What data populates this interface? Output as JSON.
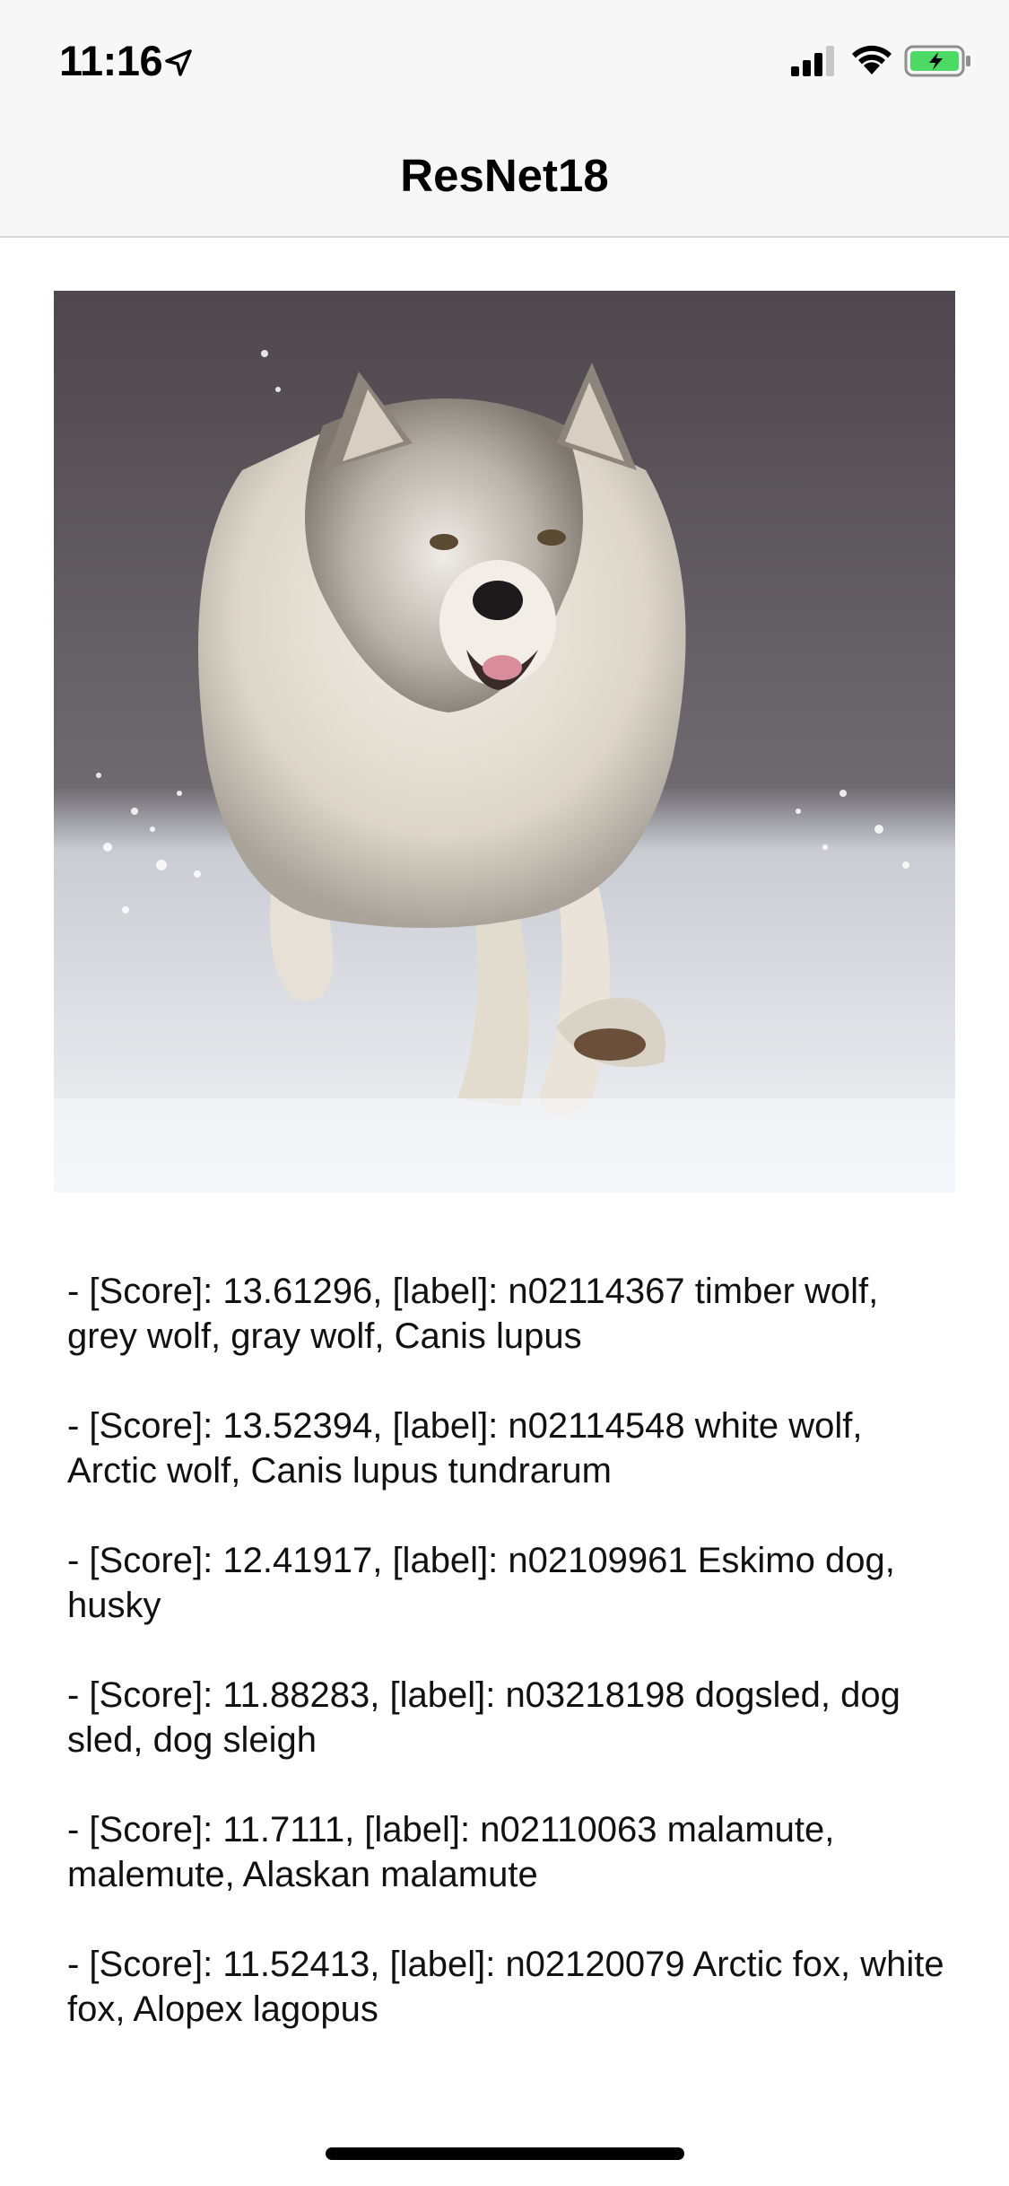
{
  "status_bar": {
    "time": "11:16",
    "icons": [
      "location-arrow-icon",
      "cellular-signal-icon",
      "wifi-icon",
      "battery-charging-icon"
    ],
    "battery_color": "#4cd964"
  },
  "nav": {
    "title": "ResNet18"
  },
  "photo": {
    "subject": "wolf-photo"
  },
  "results": [
    "- [Score]: 13.61296, [label]: n02114367 timber wolf, grey wolf, gray wolf, Canis lupus",
    "- [Score]: 13.52394, [label]: n02114548 white wolf, Arctic wolf, Canis lupus tundrarum",
    "- [Score]: 12.41917, [label]: n02109961 Eskimo dog, husky",
    "- [Score]: 11.88283, [label]: n03218198 dogsled, dog sled, dog sleigh",
    "- [Score]: 11.7111, [label]: n02110063 malamute, malemute, Alaskan malamute",
    "- [Score]: 11.52413, [label]: n02120079 Arctic fox, white fox, Alopex lagopus"
  ]
}
